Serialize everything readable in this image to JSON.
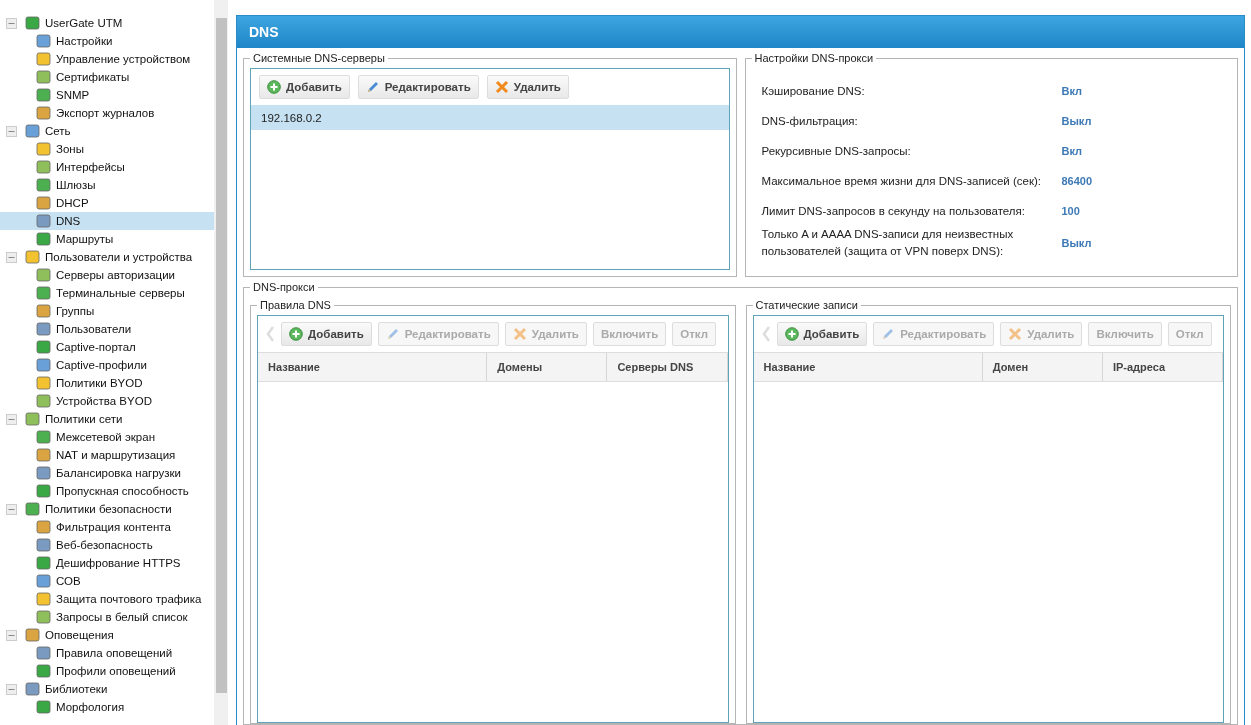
{
  "tree": [
    {
      "label": "UserGate UTM",
      "expanded": true,
      "selected": false,
      "children": [
        {
          "label": "Настройки",
          "selected": false
        },
        {
          "label": "Управление устройством",
          "selected": false
        },
        {
          "label": "Сертификаты",
          "selected": false
        },
        {
          "label": "SNMP",
          "selected": false
        },
        {
          "label": "Экспорт журналов",
          "selected": false
        }
      ]
    },
    {
      "label": "Сеть",
      "expanded": true,
      "selected": false,
      "children": [
        {
          "label": "Зоны",
          "selected": false
        },
        {
          "label": "Интерфейсы",
          "selected": false
        },
        {
          "label": "Шлюзы",
          "selected": false
        },
        {
          "label": "DHCP",
          "selected": false
        },
        {
          "label": "DNS",
          "selected": true
        },
        {
          "label": "Маршруты",
          "selected": false
        }
      ]
    },
    {
      "label": "Пользователи и устройства",
      "expanded": true,
      "selected": false,
      "children": [
        {
          "label": "Серверы авторизации",
          "selected": false
        },
        {
          "label": "Терминальные серверы",
          "selected": false
        },
        {
          "label": "Группы",
          "selected": false
        },
        {
          "label": "Пользователи",
          "selected": false
        },
        {
          "label": "Captive-портал",
          "selected": false
        },
        {
          "label": "Captive-профили",
          "selected": false
        },
        {
          "label": "Политики BYOD",
          "selected": false
        },
        {
          "label": "Устройства BYOD",
          "selected": false
        }
      ]
    },
    {
      "label": "Политики сети",
      "expanded": true,
      "selected": false,
      "children": [
        {
          "label": "Межсетевой экран",
          "selected": false
        },
        {
          "label": "NAT и маршрутизация",
          "selected": false
        },
        {
          "label": "Балансировка нагрузки",
          "selected": false
        },
        {
          "label": "Пропускная способность",
          "selected": false
        }
      ]
    },
    {
      "label": "Политики безопасности",
      "expanded": true,
      "selected": false,
      "children": [
        {
          "label": "Фильтрация контента",
          "selected": false
        },
        {
          "label": "Веб-безопасность",
          "selected": false
        },
        {
          "label": "Дешифрование HTTPS",
          "selected": false
        },
        {
          "label": "СОВ",
          "selected": false
        },
        {
          "label": "Защита почтового трафика",
          "selected": false
        },
        {
          "label": "Запросы в белый список",
          "selected": false
        }
      ]
    },
    {
      "label": "Оповещения",
      "expanded": true,
      "selected": false,
      "children": [
        {
          "label": "Правила оповещений",
          "selected": false
        },
        {
          "label": "Профили оповещений",
          "selected": false
        }
      ]
    },
    {
      "label": "Библиотеки",
      "expanded": true,
      "selected": false,
      "children": [
        {
          "label": "Морфология",
          "selected": false
        }
      ]
    }
  ],
  "panel": {
    "title": "DNS",
    "system_dns": {
      "legend": "Системные DNS-серверы",
      "buttons": [
        {
          "label": "Добавить",
          "kind": "add",
          "disabled": false
        },
        {
          "label": "Редактировать",
          "kind": "edit",
          "disabled": false
        },
        {
          "label": "Удалить",
          "kind": "delete",
          "disabled": false
        }
      ],
      "servers": [
        {
          "address": "192.168.0.2",
          "selected": true
        }
      ]
    },
    "proxy_settings": {
      "legend": "Настройки DNS-прокси",
      "rows": [
        {
          "label": "Кэширование DNS:",
          "value": "Вкл"
        },
        {
          "label": "DNS-фильтрация:",
          "value": "Выкл"
        },
        {
          "label": "Рекурсивные DNS-запросы:",
          "value": "Вкл"
        },
        {
          "label": "Максимальное время жизни для DNS-записей (сек):",
          "value": "86400"
        },
        {
          "label": "Лимит DNS-запросов в секунду на пользователя:",
          "value": "100"
        },
        {
          "label": "Только A и AAAA DNS-записи для неизвестных пользователей (защита от VPN поверх DNS):",
          "value": "Выкл"
        }
      ]
    },
    "dns_proxy": {
      "legend": "DNS-прокси",
      "grids": [
        {
          "legend": "Правила DNS",
          "scroll_left_disabled": true,
          "buttons": [
            {
              "label": "Добавить",
              "kind": "add",
              "disabled": false
            },
            {
              "label": "Редактировать",
              "kind": "edit",
              "disabled": true
            },
            {
              "label": "Удалить",
              "kind": "delete",
              "disabled": true
            },
            {
              "label": "Включить",
              "kind": "text",
              "disabled": true
            },
            {
              "label": "Откл",
              "kind": "text",
              "disabled": true
            }
          ],
          "columns": [
            "Название",
            "Домены",
            "Серверы DNS"
          ]
        },
        {
          "legend": "Статические записи",
          "scroll_left_disabled": true,
          "buttons": [
            {
              "label": "Добавить",
              "kind": "add",
              "disabled": false
            },
            {
              "label": "Редактировать",
              "kind": "edit",
              "disabled": true
            },
            {
              "label": "Удалить",
              "kind": "delete",
              "disabled": true
            },
            {
              "label": "Включить",
              "kind": "text",
              "disabled": true
            },
            {
              "label": "Откл",
              "kind": "text",
              "disabled": true
            }
          ],
          "columns": [
            "Название",
            "Домен",
            "IP-адреса"
          ]
        }
      ]
    }
  }
}
